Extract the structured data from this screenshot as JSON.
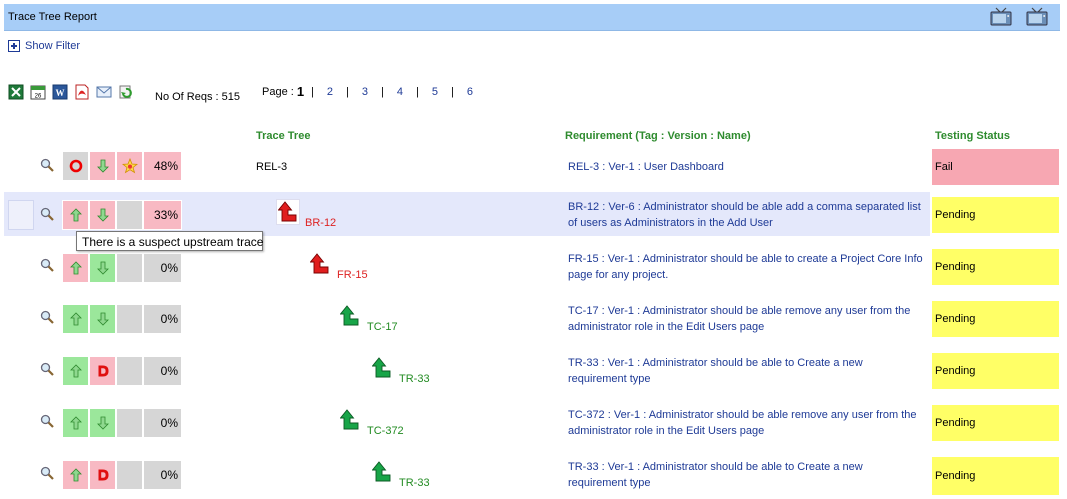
{
  "window": {
    "title": "Trace Tree Report"
  },
  "filter": {
    "label": "Show Filter"
  },
  "toolbar": {
    "icons": [
      "excel-icon",
      "calendar-icon",
      "word-icon",
      "pdf-icon",
      "email-icon",
      "refresh-icon"
    ],
    "reqs_label": "No Of Reqs : 515"
  },
  "pager": {
    "label": "Page :",
    "current": "1",
    "pages": [
      "2",
      "3",
      "4",
      "5",
      "6"
    ]
  },
  "headers": {
    "trace_tree": "Trace Tree",
    "requirement": "Requirement (Tag : Version : Name)",
    "testing_status": "Testing Status"
  },
  "tooltip": "There is a suspect upstream trace",
  "rows": [
    {
      "pct": "48%",
      "tree": "REL-3",
      "req": "REL-3 : Ver-1 : User Dashboard",
      "status": "Fail"
    },
    {
      "pct": "33%",
      "tree": "BR-12",
      "req": "BR-12 : Ver-6 : Administrator should be able add a comma separated list of users as Administrators in the Add User",
      "status": "Pending"
    },
    {
      "pct": "0%",
      "tree": "FR-15",
      "req": "FR-15 : Ver-1 : Administrator should be able to create a Project Core Info page for any project.",
      "status": "Pending"
    },
    {
      "pct": "0%",
      "tree": "TC-17",
      "req": "TC-17 : Ver-1 : Administrator should be able remove any user from the administrator role in the Edit Users page",
      "status": "Pending"
    },
    {
      "pct": "0%",
      "tree": "TR-33",
      "req": "TR-33 : Ver-1 : Administrator should be able to Create a new requirement type",
      "status": "Pending"
    },
    {
      "pct": "0%",
      "tree": "TC-372",
      "req": "TC-372 : Ver-1 : Administrator should be able remove any user from the administrator role in the Edit Users page",
      "status": "Pending"
    },
    {
      "pct": "0%",
      "tree": "TR-33",
      "req": "TR-33 : Ver-1 : Administrator should be able to Create a new requirement type",
      "status": "Pending"
    }
  ],
  "colors": {
    "title_bar": "#a7cdf7",
    "cell_red": "#f8b9c3",
    "cell_green": "#9be79b",
    "status_fail": "#f7a7b2",
    "status_pending": "#ffff66",
    "link_blue": "#1e3a96",
    "header_green": "#2e8b2e"
  }
}
